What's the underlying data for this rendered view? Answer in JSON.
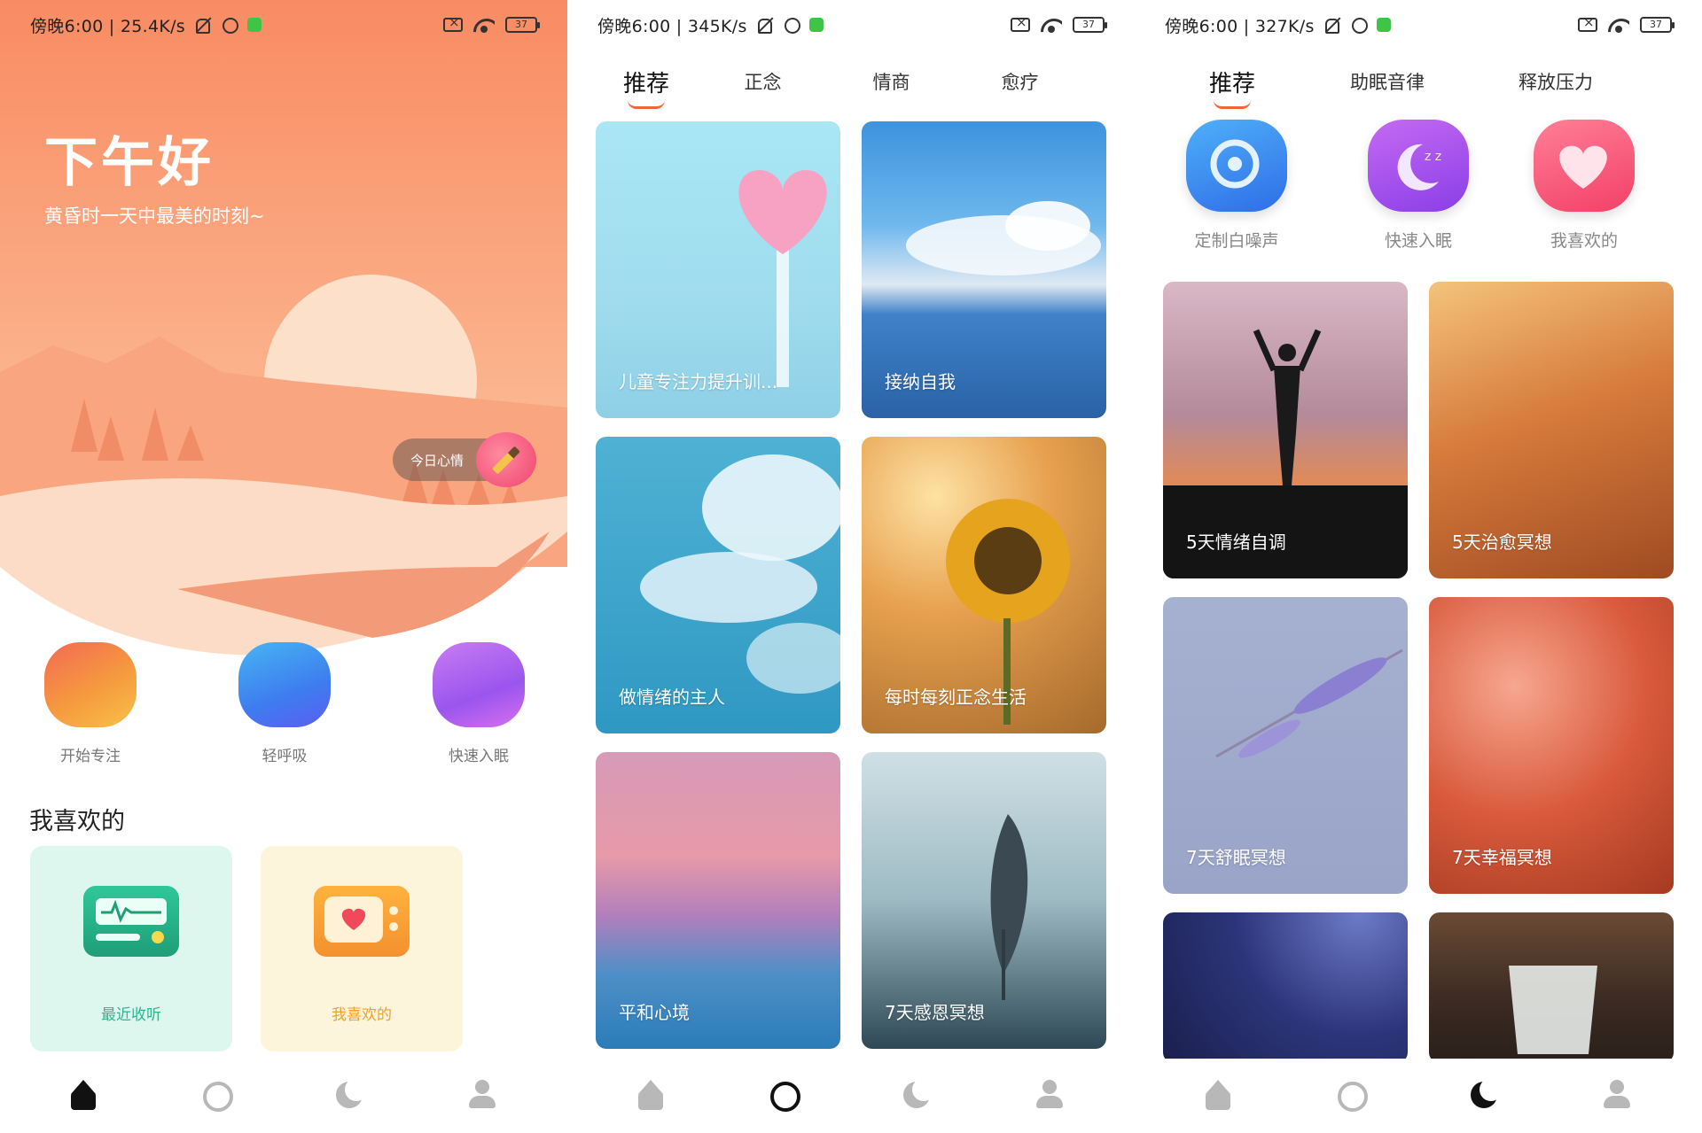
{
  "screen1": {
    "status": {
      "text": "傍晚6:00 | 25.4K/s",
      "battery": "37"
    },
    "greeting": "下午好",
    "subgreeting": "黄昏时一天中最美的时刻~",
    "mood": {
      "label": "今日心情"
    },
    "quick_actions": [
      {
        "label": "开始专注",
        "icon": "focus-icon"
      },
      {
        "label": "轻呼吸",
        "icon": "breath-icon"
      },
      {
        "label": "快速入眠",
        "icon": "sleep-icon"
      }
    ],
    "favorites_title": "我喜欢的",
    "cards": [
      {
        "label": "最近收听",
        "icon": "radio-icon",
        "color": "#2fb58c"
      },
      {
        "label": "我喜欢的",
        "icon": "tv-heart-icon",
        "color": "#f0a12a"
      }
    ],
    "active_tab": "home"
  },
  "screen2": {
    "status": {
      "text": "傍晚6:00 | 345K/s",
      "battery": "37"
    },
    "tabs": [
      "推荐",
      "正念",
      "情商",
      "愈疗"
    ],
    "tiles": [
      {
        "title": "儿童专注力提升训..."
      },
      {
        "title": "接纳自我"
      },
      {
        "title": "做情绪的主人"
      },
      {
        "title": "每时每刻正念生活"
      },
      {
        "title": "平和心境"
      },
      {
        "title": "7天感恩冥想"
      }
    ],
    "active_tab": "discover"
  },
  "screen3": {
    "status": {
      "text": "傍晚6:00 | 327K/s",
      "battery": "37"
    },
    "tabs": [
      "推荐",
      "助眠音律",
      "释放压力"
    ],
    "features": [
      {
        "label": "定制白噪声",
        "icon": "white-noise-icon"
      },
      {
        "label": "快速入眠",
        "icon": "moon-zzz-icon"
      },
      {
        "label": "我喜欢的",
        "icon": "heart-icon"
      }
    ],
    "tiles": [
      {
        "title": "5天情绪自调"
      },
      {
        "title": "5天治愈冥想"
      },
      {
        "title": "7天舒眠冥想"
      },
      {
        "title": "7天幸福冥想"
      },
      {
        "title": ""
      },
      {
        "title": ""
      }
    ],
    "active_tab": "sleep"
  },
  "colors": {
    "accent": "#f0663a",
    "tab_active": "#111111",
    "tab_inactive": "#b8b8b8"
  }
}
